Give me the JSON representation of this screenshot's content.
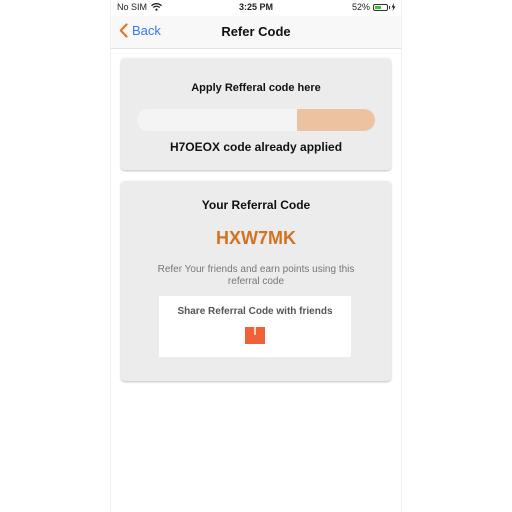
{
  "status_bar": {
    "carrier": "No SIM",
    "time": "3:25 PM",
    "battery_percent": "52%",
    "battery_level": 0.52,
    "icons": [
      "wifi-icon",
      "battery-icon",
      "charging-icon"
    ]
  },
  "nav": {
    "back_label": "Back",
    "title": "Refer Code",
    "back_icon": "chevron-left-icon"
  },
  "apply_card": {
    "title": "Apply Refferal code here",
    "input_value": "",
    "input_placeholder": "",
    "apply_button_label": "",
    "applied_text": "H7OEOX code already applied"
  },
  "referral_card": {
    "title": "Your Referral Code",
    "code": "HXW7MK",
    "description": "Refer Your friends and earn points using this referral code",
    "share_label": "Share Referral Code with friends",
    "share_icon": "share-icon"
  },
  "colors": {
    "accent": "#e0782c",
    "code_color": "#d4721f",
    "link_blue": "#3478f6",
    "apply_button": "#ecc2a1",
    "share_icon": "#ef6237",
    "card_bg": "#ececec"
  }
}
